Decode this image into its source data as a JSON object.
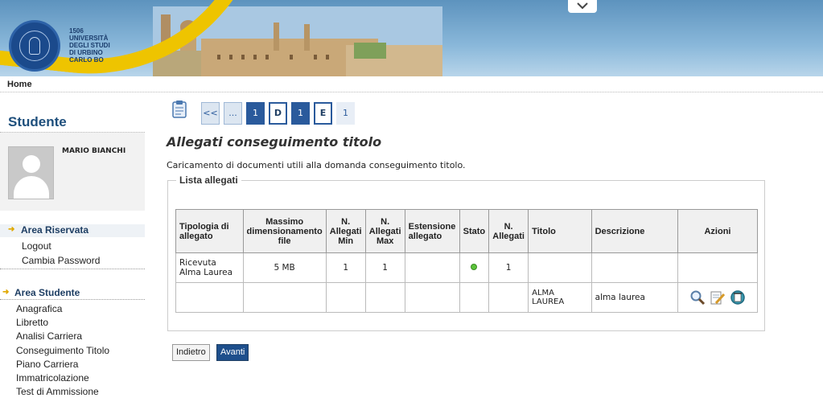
{
  "header": {
    "university_lines": "1506\nUNIVERSITÀ\nDEGLI STUDI\nDI URBINO\nCARLO BO"
  },
  "topbar": {
    "home": "Home"
  },
  "sidebar": {
    "title": "Studente",
    "user_name": "MARIO BIANCHI",
    "reserved_area": {
      "label": "Area Riservata",
      "items": [
        "Logout",
        "Cambia Password"
      ]
    },
    "student_area": {
      "label": "Area Studente",
      "items": [
        "Anagrafica",
        "Libretto",
        "Analisi Carriera",
        "Conseguimento Titolo",
        "Piano Carriera",
        "Immatricolazione",
        "Test di Ammissione"
      ]
    }
  },
  "pager": [
    "<<",
    "...",
    "1",
    "D",
    "1",
    "E",
    "1"
  ],
  "page": {
    "title": "Allegati conseguimento titolo",
    "intro": "Caricamento di documenti utili alla domanda conseguimento titolo.",
    "section_title": "Lista allegati"
  },
  "table": {
    "headers": [
      "Tipologia di allegato",
      "Massimo dimensionamento file",
      "N. Allegati Min",
      "N. Allegati Max",
      "Estensione allegato",
      "Stato",
      "N. Allegati",
      "Titolo",
      "Descrizione",
      "Azioni"
    ],
    "rows": [
      {
        "tipologia": "Ricevuta Alma Laurea",
        "max_dim": "5 MB",
        "min": "1",
        "max": "1",
        "estensione": "",
        "stato": "green",
        "n_allegati": "1",
        "titolo": "",
        "descrizione": ""
      },
      {
        "tipologia": "",
        "max_dim": "",
        "min": "",
        "max": "",
        "estensione": "",
        "stato": "",
        "n_allegati": "",
        "titolo": "ALMA LAUREA",
        "descrizione": "alma laurea"
      }
    ],
    "actions": [
      "view-icon",
      "edit-icon",
      "delete-icon"
    ]
  },
  "buttons": {
    "back": "Indietro",
    "next": "Avanti"
  },
  "colors": {
    "brand_blue": "#1e4f7c",
    "accent_yellow": "#eec400",
    "status_green": "#5bc33a"
  }
}
